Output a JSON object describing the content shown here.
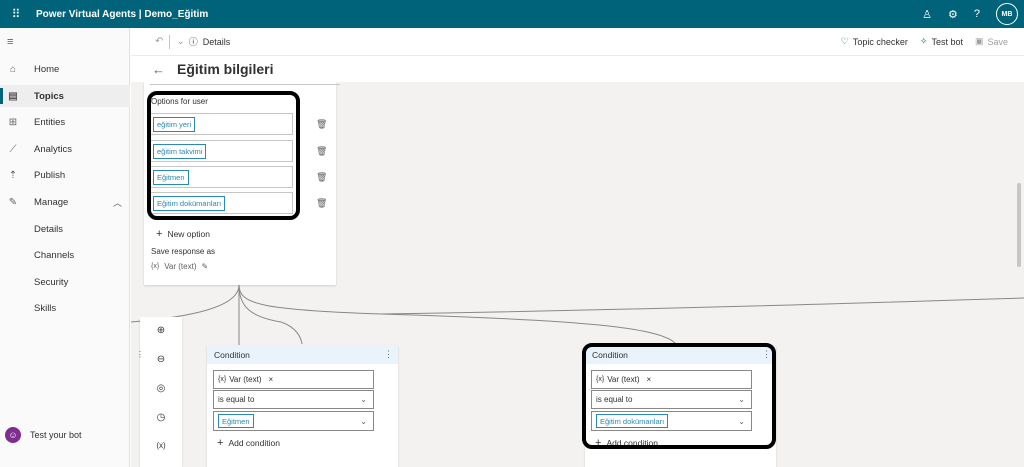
{
  "app": {
    "title": "Power Virtual Agents | Demo_Eğitim",
    "avatar_initials": "MB",
    "accent": "#006379"
  },
  "sidebar": {
    "items": [
      {
        "label": "Home",
        "icon": "home-icon"
      },
      {
        "label": "Topics",
        "icon": "topics-icon",
        "active": true
      },
      {
        "label": "Entities",
        "icon": "entities-icon"
      },
      {
        "label": "Analytics",
        "icon": "analytics-icon"
      },
      {
        "label": "Publish",
        "icon": "publish-icon"
      },
      {
        "label": "Manage",
        "icon": "wrench-icon"
      },
      {
        "label": "Details"
      },
      {
        "label": "Channels"
      },
      {
        "label": "Security"
      },
      {
        "label": "Skills"
      }
    ],
    "test_bot": "Test your bot"
  },
  "cmdbar": {
    "details": "Details",
    "topic_checker": "Topic checker",
    "test_bot": "Test bot",
    "save": "Save"
  },
  "page": {
    "title": "Eğitim bilgileri"
  },
  "question": {
    "options_label": "Options for user",
    "options": [
      "eğitim yeri",
      "eğitim takvimi",
      "Eğitmen",
      "Eğitim dokümanları"
    ],
    "new_option": "New option",
    "save_response_label": "Save response as",
    "var_prefix": "{x}",
    "var_name": "Var (text)"
  },
  "zoom_tools": [
    "zoom-in-icon",
    "zoom-out-icon",
    "center-icon",
    "history-icon",
    "variables-icon"
  ],
  "conditions": [
    {
      "title": "Condition",
      "var_prefix": "{x}",
      "var": "Var (text)",
      "operator": "is equal to",
      "value": "Eğitmen",
      "add": "Add condition"
    },
    {
      "title": "Condition",
      "var_prefix": "{x}",
      "var": "Var (text)",
      "operator": "is equal to",
      "value": "Eğitim dokümanları",
      "add": "Add condition"
    }
  ]
}
